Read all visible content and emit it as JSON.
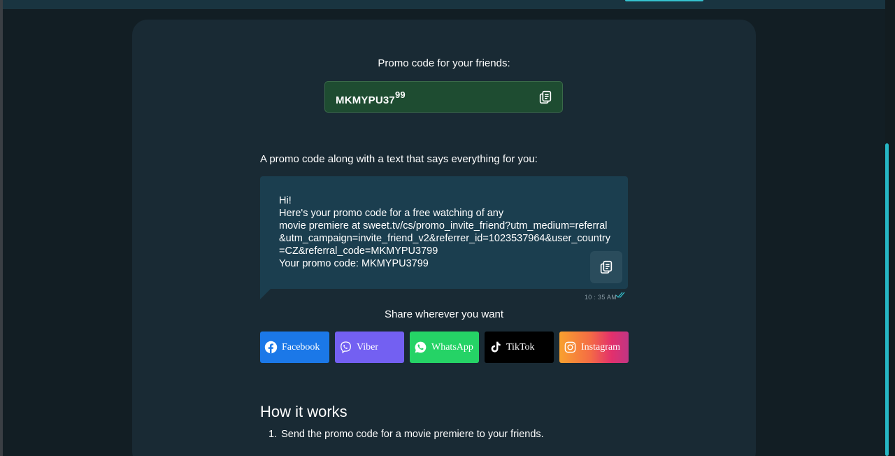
{
  "promo": {
    "label": "Promo code for your friends:",
    "code": "MKMYPU37",
    "code_suffix": "99",
    "copy_icon": "copy-icon"
  },
  "message": {
    "label": "A promo code along with a text that says everything for you:",
    "text": "Hi!\nHere's your promo code for a free watching of any\nmovie premiere at sweet.tv/cs/promo_invite_friend?utm_medium=referral\n&utm_campaign=invite_friend_v2&referrer_id=1023537964&user_country\n=CZ&referral_code=MKMYPU3799\nYour promo code: MKMYPU3799",
    "time": "10 : 35 AM",
    "copy_icon": "copy-icon"
  },
  "share": {
    "label": "Share wherever you want",
    "buttons": [
      {
        "label": "Facebook",
        "icon": "facebook-icon",
        "color": "#1b78e8"
      },
      {
        "label": "Viber",
        "icon": "viber-icon",
        "color": "#7360f2"
      },
      {
        "label": "WhatsApp",
        "icon": "whatsapp-icon",
        "color": "#25d366"
      },
      {
        "label": "TikTok",
        "icon": "tiktok-icon",
        "color": "#000000"
      },
      {
        "label": "Instagram",
        "icon": "instagram-icon",
        "color": "#e3306c"
      }
    ]
  },
  "how_it_works": {
    "title": "How it works",
    "steps": [
      {
        "number": "1.",
        "text": "Send the promo code for a movie premiere to your friends."
      }
    ]
  },
  "colors": {
    "background": "#121e24",
    "card": "#192a34",
    "promo_box": "#1e4c31",
    "bubble": "#1b3e4f",
    "accent": "#26b7c5"
  }
}
